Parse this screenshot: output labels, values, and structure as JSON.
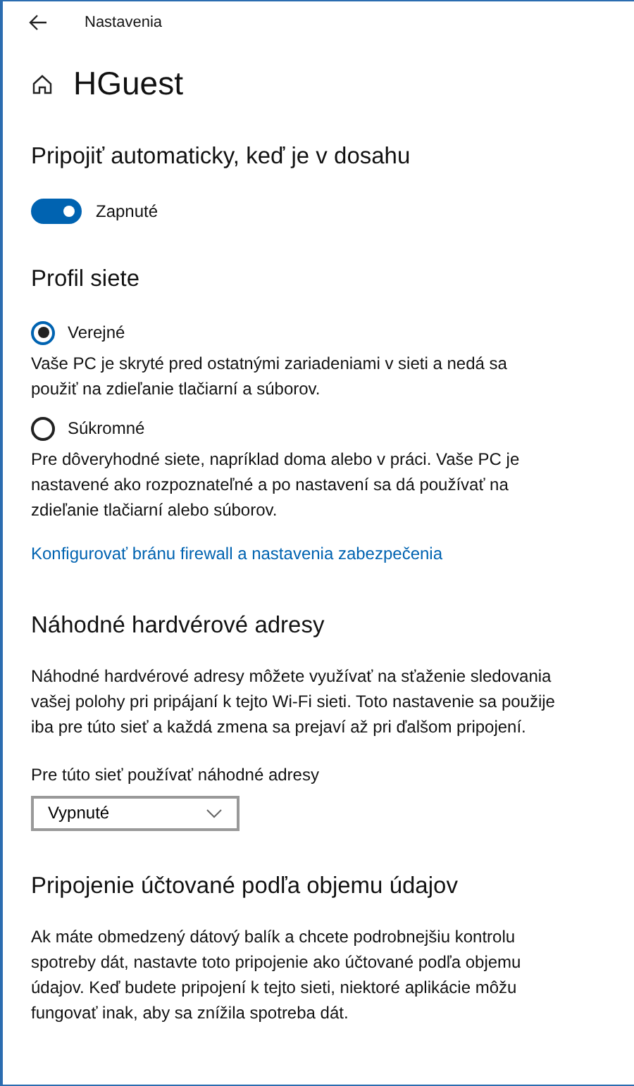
{
  "window": {
    "title": "Nastavenia"
  },
  "page": {
    "title": "HGuest"
  },
  "sections": [
    {
      "kind": "toggle",
      "heading": "Pripojiť automaticky, keď je v dosahu",
      "toggle": {
        "label": "Zapnuté",
        "on": true
      }
    },
    {
      "kind": "radios",
      "heading": "Profil siete",
      "options": [
        {
          "label": "Verejné",
          "selected": true,
          "description": "Vaše PC je skryté pred ostatnými zariadeniami v sieti a nedá sa použiť na zdieľanie tlačiarní a súborov."
        },
        {
          "label": "Súkromné",
          "selected": false,
          "description": "Pre dôveryhodné siete, napríklad doma alebo v práci. Vaše PC je nastavené ako rozpoznateľné a po nastavení sa dá používať na zdieľanie tlačiarní alebo súborov."
        }
      ],
      "link": "Konfigurovať bránu firewall a nastavenia zabezpečenia"
    },
    {
      "kind": "dropdown",
      "heading": "Náhodné hardvérové adresy",
      "description": "Náhodné hardvérové adresy môžete využívať na sťaženie sledovania vašej polohy pri pripájaní k tejto Wi-Fi sieti. Toto nastavenie sa použije iba pre túto sieť a každá zmena sa prejaví až pri ďalšom pripojení.",
      "field_label": "Pre túto sieť používať náhodné adresy",
      "dropdown": {
        "value": "Vypnuté"
      }
    },
    {
      "kind": "text",
      "heading": "Pripojenie účtované podľa objemu údajov",
      "description": "Ak máte obmedzený dátový balík a chcete podrobnejšiu kontrolu spotreby dát, nastavte toto pripojenie ako účtované podľa objemu údajov. Keď budete pripojení k tejto sieti, niektoré aplikácie môžu fungovať inak, aby sa znížila spotreba dát."
    }
  ]
}
